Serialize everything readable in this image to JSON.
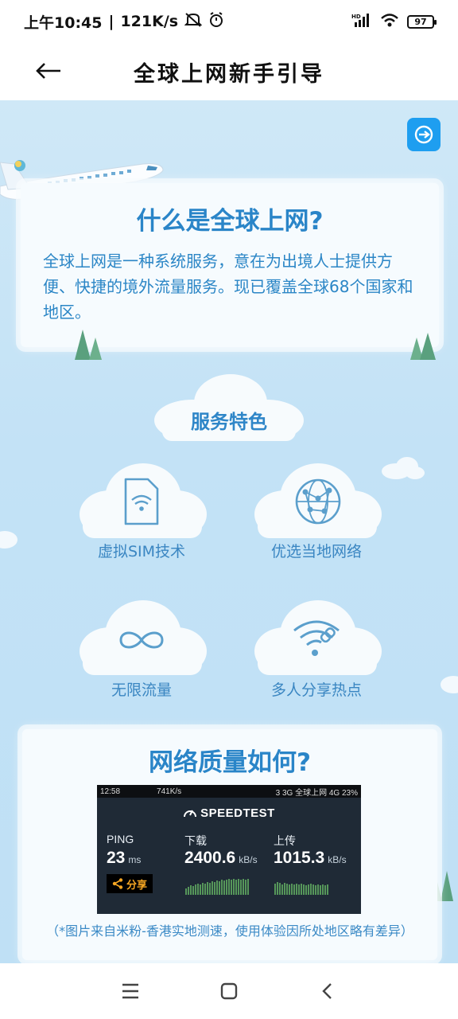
{
  "status_bar": {
    "time": "上午10:45",
    "speed": "121K/s",
    "network": "HD",
    "battery": "97"
  },
  "header": {
    "title": "全球上网新手引导",
    "back_icon": "back-arrow-icon"
  },
  "intro": {
    "title": "什么是全球上网?",
    "body": "全球上网是一种系统服务，意在为出境人士提供方便、快捷的境外流量服务。现已覆盖全球68个国家和地区。"
  },
  "features": {
    "heading": "服务特色",
    "items": [
      {
        "label": "虚拟SIM技术",
        "icon": "sim-card-icon"
      },
      {
        "label": "优选当地网络",
        "icon": "globe-network-icon"
      },
      {
        "label": "无限流量",
        "icon": "infinity-icon"
      },
      {
        "label": "多人分享热点",
        "icon": "wifi-share-icon"
      }
    ]
  },
  "quality": {
    "title": "网络质量如何?",
    "note": "（*图片来自米粉-香港实地测速，使用体验因所处地区略有差异）",
    "speedtest": {
      "status_time": "12:58",
      "status_info": "741K/s",
      "status_right": "3 3G 全球上网 4G 23%",
      "logo": "SPEEDTEST",
      "ping_label": "PING",
      "ping_value": "23",
      "ping_unit": "ms",
      "download_label": "下载",
      "download_value": "2400.6",
      "download_unit": "kB/s",
      "upload_label": "上传",
      "upload_value": "1015.3",
      "upload_unit": "kB/s",
      "share_label": "分享"
    }
  },
  "colors": {
    "accent": "#2a85c8",
    "sky": "#c3e2f6",
    "share_button": "#1e9ef0"
  }
}
